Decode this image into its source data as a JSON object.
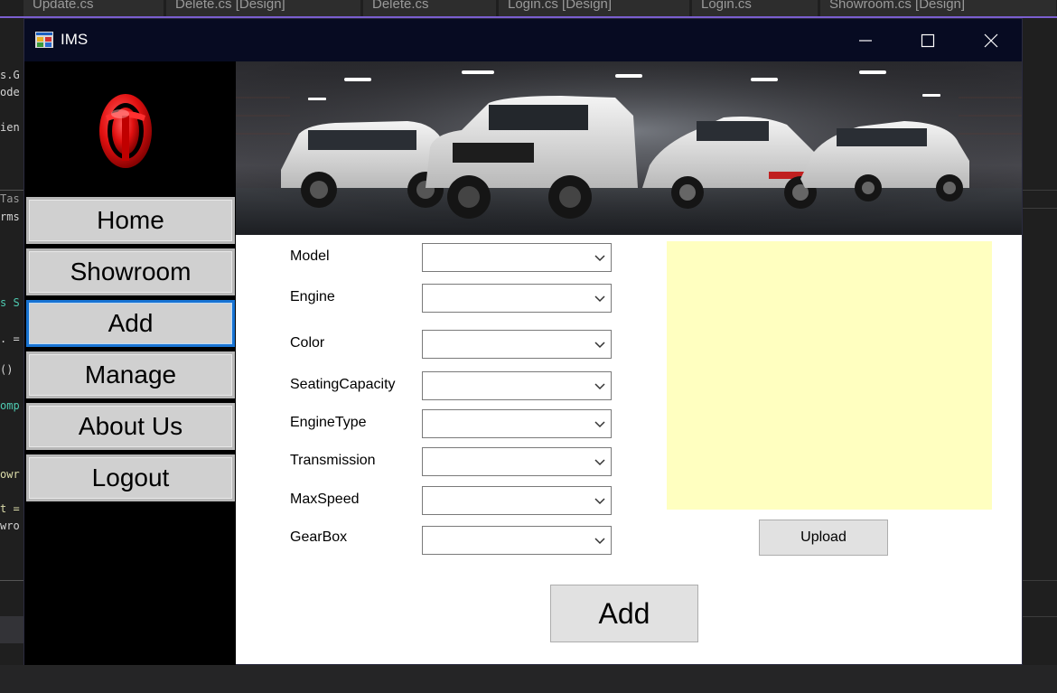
{
  "ide": {
    "tabs": [
      "Update.cs",
      "Delete.cs [Design]",
      "Delete.cs",
      "Login.cs [Design]",
      "Login.cs",
      "Showroom.cs [Design]"
    ],
    "code_fragments": [
      "s.G",
      "ode",
      "ien",
      "Tas",
      "rms",
      "s S",
      ". =",
      "()",
      "omp",
      "owr",
      "t =",
      "wro"
    ]
  },
  "window": {
    "title": "IMS",
    "controls": {
      "minimize": "—",
      "maximize": "☐",
      "close": "✕"
    }
  },
  "sidebar": {
    "items": [
      {
        "label": "Home"
      },
      {
        "label": "Showroom"
      },
      {
        "label": "Add"
      },
      {
        "label": "Manage"
      },
      {
        "label": "About Us"
      },
      {
        "label": "Logout"
      }
    ],
    "active_item": "Add"
  },
  "form": {
    "fields": [
      {
        "label": "Model",
        "value": ""
      },
      {
        "label": "Engine",
        "value": ""
      },
      {
        "label": "Color",
        "value": ""
      },
      {
        "label": "SeatingCapacity",
        "value": ""
      },
      {
        "label": "EngineType",
        "value": ""
      },
      {
        "label": "Transmission",
        "value": ""
      },
      {
        "label": "MaxSpeed",
        "value": ""
      },
      {
        "label": "GearBox",
        "value": ""
      }
    ],
    "upload_label": "Upload",
    "submit_label": "Add"
  },
  "colors": {
    "titlebar": "#070b22",
    "sidebar": "#000000",
    "active_border": "#1873d3",
    "image_preview_bg": "#ffffc0",
    "logo_red": "#e01010"
  }
}
